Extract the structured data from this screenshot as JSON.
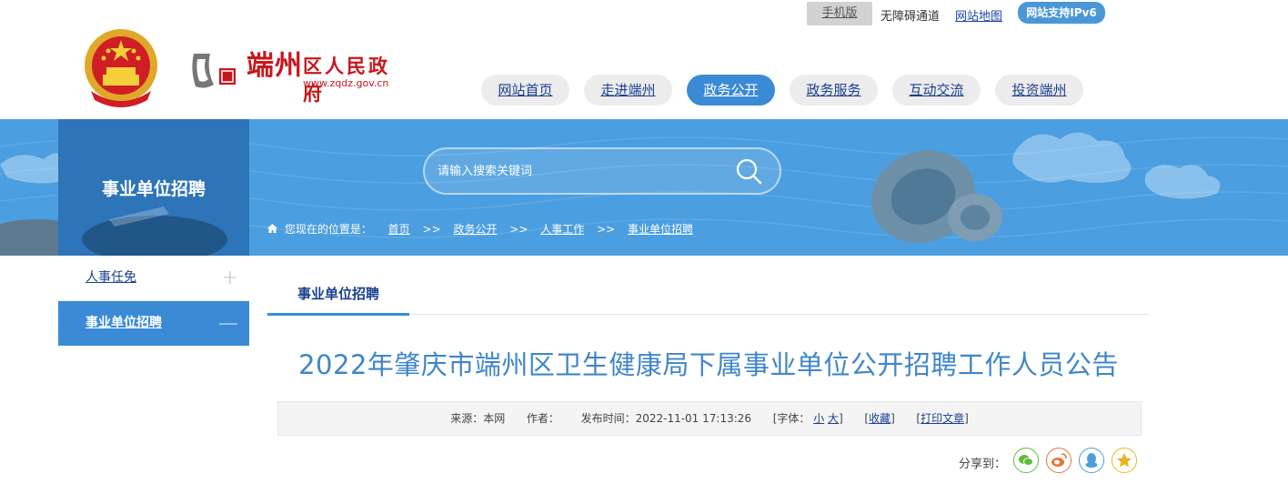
{
  "topbar": {
    "mobile_label": "手机版",
    "accessibility_label": "无障碍通道",
    "sitemap_label": "网站地图",
    "ipv6_label": "网站支持IPv6"
  },
  "logo": {
    "name_big": "端州",
    "name_rest": "区人民政府",
    "url": "www.zqdz.gov.cn"
  },
  "nav": {
    "items": [
      {
        "label": "网站首页",
        "active": false
      },
      {
        "label": "走进端州",
        "active": false
      },
      {
        "label": "政务公开",
        "active": true
      },
      {
        "label": "政务服务",
        "active": false
      },
      {
        "label": "互动交流",
        "active": false
      },
      {
        "label": "投资端州",
        "active": false
      }
    ]
  },
  "banner": {
    "section_title": "事业单位招聘"
  },
  "search": {
    "placeholder": "请输入搜索关键词"
  },
  "breadcrumb": {
    "label": "您现在的位置是：",
    "items": [
      "首页",
      "政务公开",
      "人事工作",
      "事业单位招聘"
    ]
  },
  "sidebar": {
    "items": [
      {
        "label": "人事任免",
        "toggle": "+",
        "active": false
      },
      {
        "label": "事业单位招聘",
        "toggle": "—",
        "active": true
      }
    ]
  },
  "main": {
    "tab_label": "事业单位招聘",
    "article_title": "2022年肇庆市端州区卫生健康局下属事业单位公开招聘工作人员公告",
    "meta": {
      "source_label": "来源：",
      "source_value": "本网",
      "author_label": "作者：",
      "publish_label": "发布时间：",
      "publish_time": "2022-11-01 17:13:26",
      "font_label": "[字体：",
      "font_small": "小",
      "font_large": "大",
      "bracket_close": "]",
      "favorite": "收藏",
      "print": "打印文章"
    },
    "share_label": "分享到："
  },
  "colors": {
    "accent": "#3a8ad6",
    "banner": "#4b9ee0",
    "banner_dark": "#2d74b8",
    "brand_red": "#c8161d"
  }
}
